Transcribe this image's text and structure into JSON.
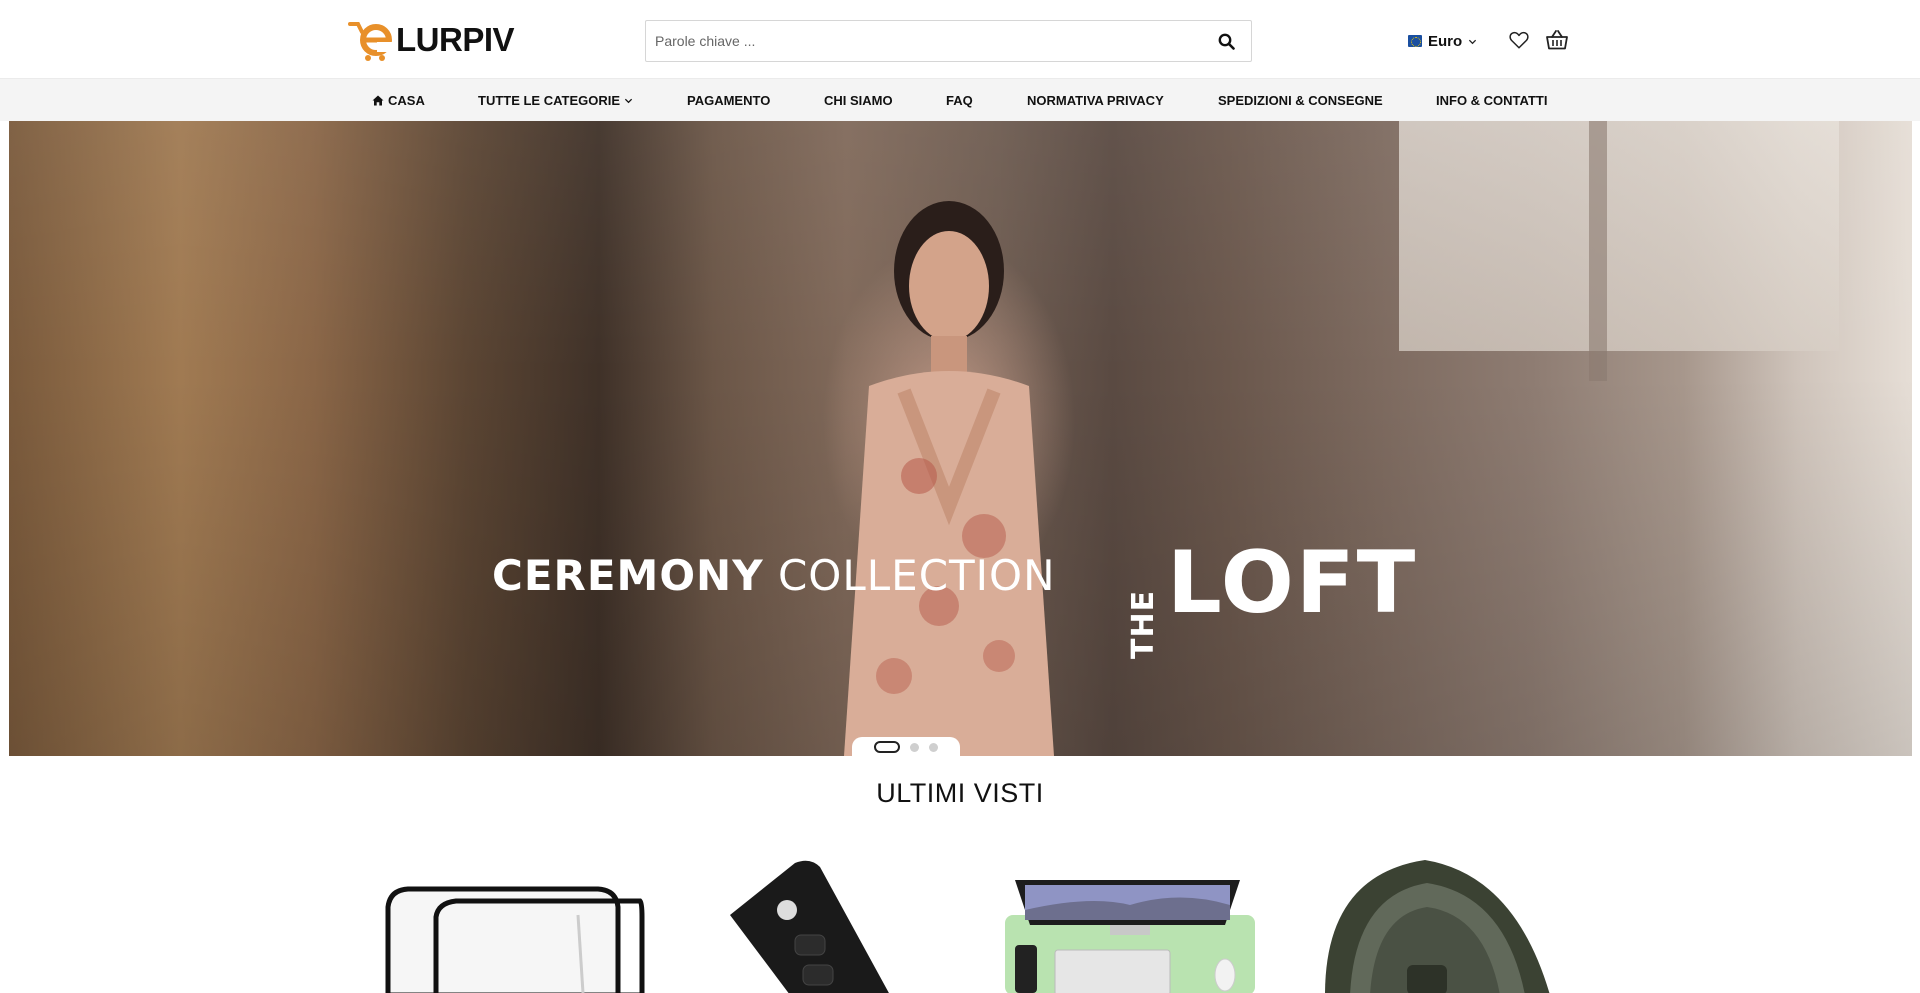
{
  "header": {
    "logo_text": "LURPIV",
    "search": {
      "placeholder": "Parole chiave ..."
    },
    "currency": {
      "label": "Euro"
    }
  },
  "nav": {
    "items": [
      {
        "label": "CASA",
        "icon": "home-icon"
      },
      {
        "label": "TUTTE LE CATEGORIE",
        "icon": "chevron-down-icon"
      },
      {
        "label": "PAGAMENTO"
      },
      {
        "label": "CHI SIAMO"
      },
      {
        "label": "FAQ"
      },
      {
        "label": "NORMATIVA PRIVACY"
      },
      {
        "label": "SPEDIZIONI & CONSEGNE"
      },
      {
        "label": "INFO & CONTATTI"
      }
    ]
  },
  "hero": {
    "headline_bold": "CEREMONY",
    "headline_light": "COLLECTION",
    "brand_small": "THE",
    "brand_large": "LOFT",
    "slides_count": 3,
    "active_slide": 1
  },
  "recently_viewed": {
    "title": "ULTIMI VISTI",
    "products": [
      {
        "image": "clear-storage-cube"
      },
      {
        "image": "car-key-fob"
      },
      {
        "image": "desk-mat-with-computer"
      },
      {
        "image": "gas-mask"
      }
    ]
  },
  "colors": {
    "logo_accent": "#e8902a",
    "nav_background": "#f4f4f4",
    "text": "#111111"
  }
}
